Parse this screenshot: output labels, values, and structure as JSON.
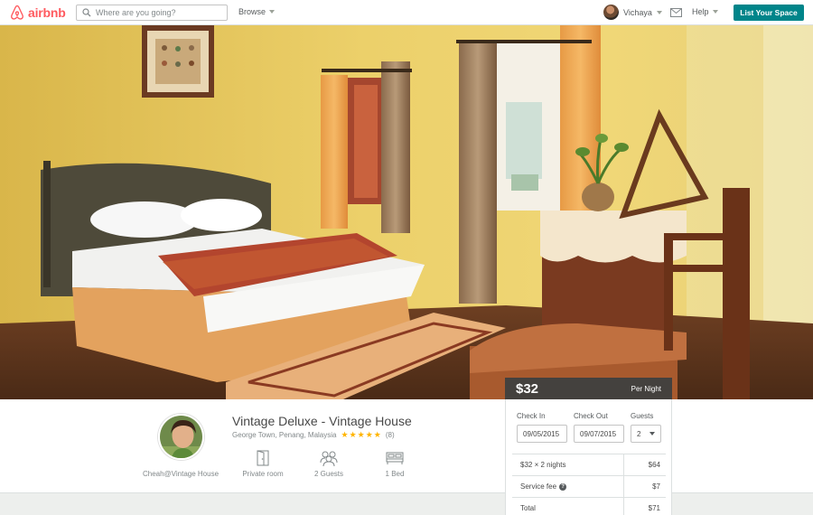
{
  "nav": {
    "brand": "airbnb",
    "search_placeholder": "Where are you going?",
    "browse_label": "Browse",
    "user_name": "Vichaya",
    "help_label": "Help",
    "list_space_label": "List Your Space",
    "brand_color": "#ff5a5f",
    "accent_color": "#00858a"
  },
  "listing": {
    "title": "Vintage Deluxe - Vintage House",
    "location": "George Town, Penang, Malaysia",
    "rating_stars": 5,
    "review_count": "(8)",
    "host_name": "Cheah@Vintage House",
    "amenities": [
      {
        "icon": "door-icon",
        "label": "Private room"
      },
      {
        "icon": "guests-icon",
        "label": "2 Guests"
      },
      {
        "icon": "bed-icon",
        "label": "1 Bed"
      }
    ]
  },
  "booking": {
    "price": "$32",
    "per_label": "Per Night",
    "check_in_label": "Check In",
    "check_in_value": "09/05/2015",
    "check_out_label": "Check Out",
    "check_out_value": "09/07/2015",
    "guests_label": "Guests",
    "guests_value": "2",
    "rows": [
      {
        "label": "$32 × 2 nights",
        "value": "$64"
      },
      {
        "label": "Service fee",
        "value": "$7"
      },
      {
        "label": "Total",
        "value": "$71"
      }
    ]
  }
}
